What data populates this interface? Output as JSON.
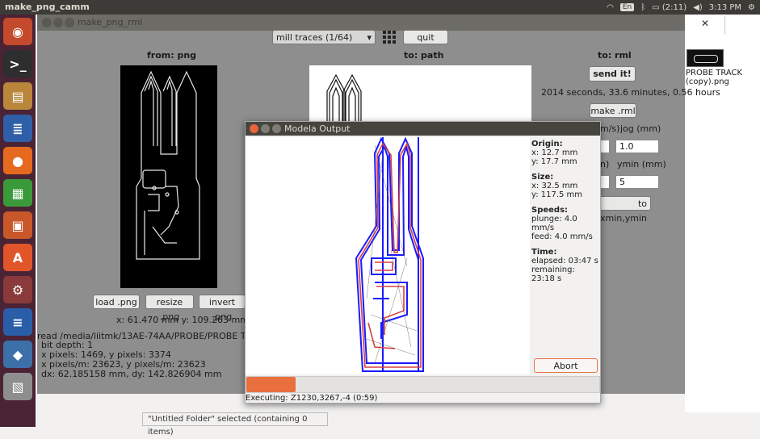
{
  "system_bar": {
    "app_title": "make_png_camm",
    "keyboard": "En",
    "battery": "(2:11)",
    "clock": "3:13 PM"
  },
  "main_window": {
    "title": "make_png_rml",
    "mode_select": "mill traces (1/64)",
    "quit_label": "quit",
    "from_label": "from: png",
    "to_path_label": "to: path",
    "to_rml_label": "to: rml",
    "send_label": "send it!",
    "estimate": "2014 seconds, 33.6 minutes, 0.56 hours",
    "make_rml_label": "make .rml",
    "speed_label": "m/s)",
    "jog_label": "jog (mm)",
    "jog_value": "1.0",
    "xmin_label": "n)",
    "ymin_label": "ymin (mm)",
    "ymin_value": "5",
    "move_label": "to xmin,ymin",
    "load_label": "load .png",
    "resize_label": "resize .png",
    "invert_label": "invert .png",
    "size_readout": "x: 61.470 mm  y: 109.263 mm",
    "file_info": [
      "read /media/liitmk/13AE-74AA/PROBE/PROBE TRACK ve",
      "bit depth: 1",
      "x pixels: 1469, y pixels: 3374",
      "x pixels/m: 23623, y pixels/m: 23623",
      "dx: 62.185158 mm, dy: 142.826904 mm"
    ]
  },
  "modela": {
    "title": "Modela Output",
    "origin_h": "Origin:",
    "origin_x": "x: 12.7 mm",
    "origin_y": "y: 17.7 mm",
    "size_h": "Size:",
    "size_x": "x: 32.5 mm",
    "size_y": "y: 117.5 mm",
    "speeds_h": "Speeds:",
    "plunge": "plunge: 4.0 mm/s",
    "feed": "feed: 4.0 mm/s",
    "time_h": "Time:",
    "elapsed": "elapsed: 03:47 s",
    "remaining": "remaining: 23:18 s",
    "abort_label": "Abort",
    "progress": 0.14,
    "executing": "Executing: Z1230,3267,-4 (0:59)"
  },
  "desktop": {
    "file_label_1": "PROBE TRACK",
    "file_label_2": "(copy).png",
    "status_text": "\"Untitled Folder\" selected  (containing 0 items)"
  },
  "colors": {
    "accent": "#e9703e",
    "trace_blue": "#1a1aff",
    "trace_red": "#d84040"
  }
}
